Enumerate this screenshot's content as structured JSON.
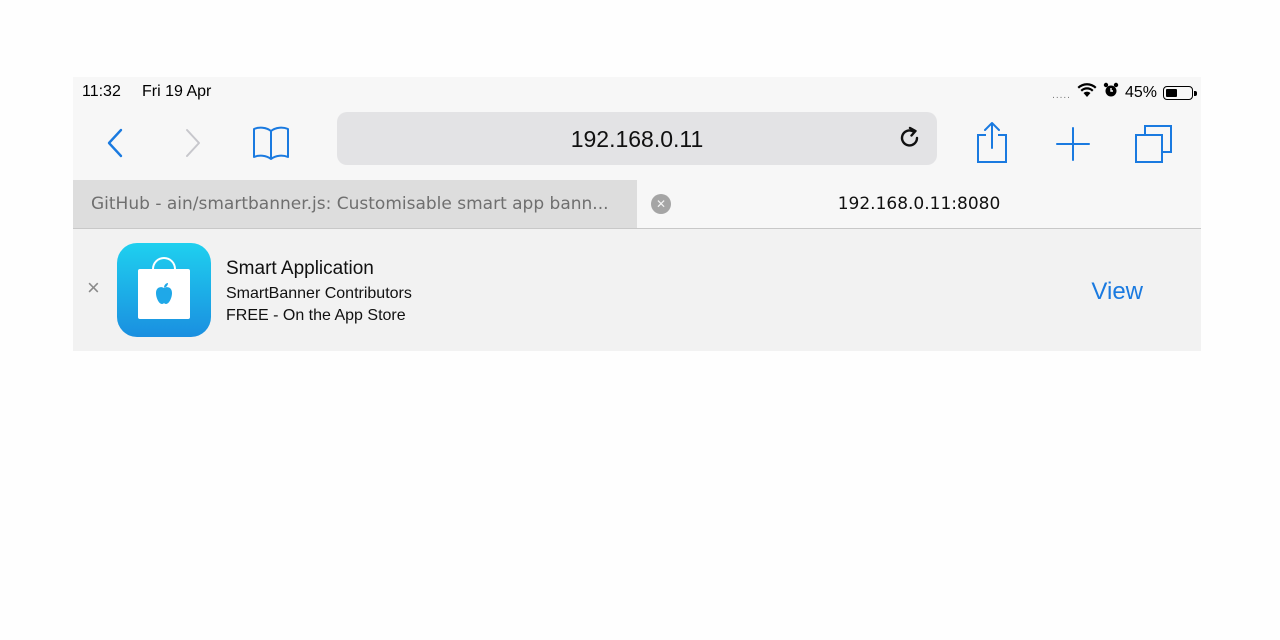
{
  "status": {
    "time": "11:32",
    "date": "Fri 19 Apr",
    "signal": ".....",
    "battery_text": "45%",
    "battery_level": 0.45
  },
  "toolbar": {
    "url": "192.168.0.11"
  },
  "tabs": [
    {
      "title": "GitHub - ain/smartbanner.js: Customisable smart app bann...",
      "active": false
    },
    {
      "title": "192.168.0.11:8080",
      "active": true
    }
  ],
  "banner": {
    "close": "×",
    "app_name": "Smart Application",
    "author": "SmartBanner Contributors",
    "price": "FREE - On the App Store",
    "view_label": "View"
  },
  "colors": {
    "accent": "#1a7ae0",
    "icon_top": "#1fd0ef",
    "icon_bottom": "#1a8fe0"
  }
}
